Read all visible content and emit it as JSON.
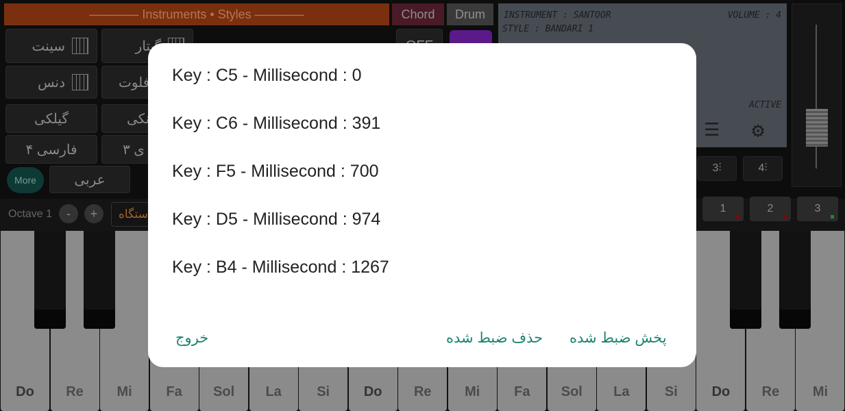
{
  "header": {
    "title": "———— Instruments • Styles ————",
    "tabs": [
      "Chord",
      "Drum"
    ]
  },
  "instruments": {
    "col1": [
      "سینت",
      "دنس"
    ],
    "col2": [
      "گیتار",
      "فلوت"
    ]
  },
  "styles": {
    "col1": [
      "گیلکی",
      "فارسی ۴"
    ],
    "col2": [
      "نکی",
      "ی ۳"
    ],
    "more": "More",
    "row5": [
      "عربی"
    ]
  },
  "off_label": "OFF",
  "lcd": {
    "instrument": "INSTRUMENT : SANTOOR",
    "volume": "VOLUME : 4",
    "style": "STYLE : BANDARI 1",
    "status": "ACTIVE"
  },
  "waves": [
    "3",
    "4"
  ],
  "loops": [
    {
      "n": "1",
      "color": "#8b0000"
    },
    {
      "n": "2",
      "color": "#8b0000"
    },
    {
      "n": "3",
      "color": "#1f8a2a"
    }
  ],
  "octave": {
    "label": "Octave 1",
    "minus": "-",
    "plus": "+",
    "dastgah": "ستگاه"
  },
  "keys": [
    "Do",
    "Re",
    "Mi",
    "Fa",
    "Sol",
    "La",
    "Si",
    "Do",
    "Re",
    "Mi",
    "Fa",
    "Sol",
    "La",
    "Si",
    "Do",
    "Re",
    "Mi"
  ],
  "dialog": {
    "rows": [
      "Key : C5 - Millisecond : 0",
      "Key : C6 - Millisecond : 391",
      "Key : F5 - Millisecond : 700",
      "Key : D5 - Millisecond : 974",
      "Key : B4 - Millisecond : 1267"
    ],
    "exit": "خروج",
    "delete": "حذف ضبط شده",
    "play": "پخش ضبط شده"
  },
  "accent": "#1b8470"
}
